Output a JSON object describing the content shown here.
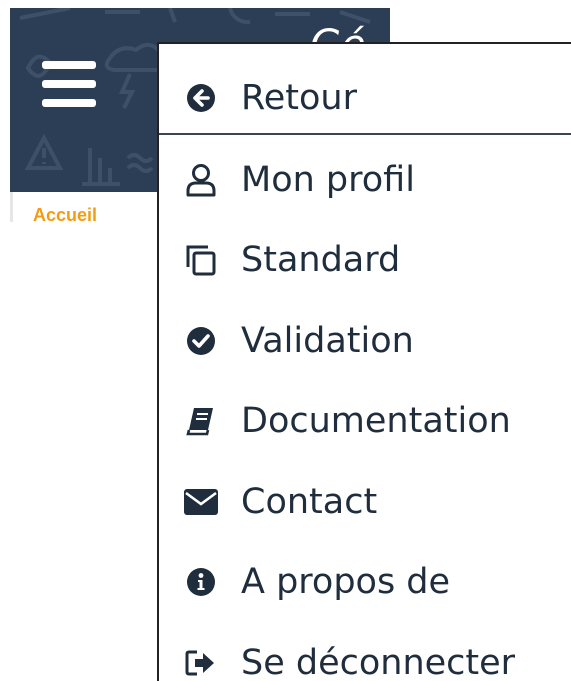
{
  "header": {
    "title_fragment": "Gé",
    "bg_color": "#2c3e55"
  },
  "breadcrumb": {
    "home_label": "Accueil",
    "accent_color": "#f39c12"
  },
  "menu": {
    "back": {
      "label": "Retour",
      "icon": "arrow-left-circle-icon"
    },
    "items": [
      {
        "label": "Mon profil",
        "icon": "user-icon"
      },
      {
        "label": "Standard",
        "icon": "copy-icon"
      },
      {
        "label": "Validation",
        "icon": "check-circle-icon"
      },
      {
        "label": "Documentation",
        "icon": "book-icon"
      },
      {
        "label": "Contact",
        "icon": "envelope-icon"
      },
      {
        "label": "A propos de",
        "icon": "info-circle-icon"
      },
      {
        "label": "Se déconnecter",
        "icon": "sign-out-icon"
      }
    ],
    "text_color": "#1f2d3d"
  }
}
